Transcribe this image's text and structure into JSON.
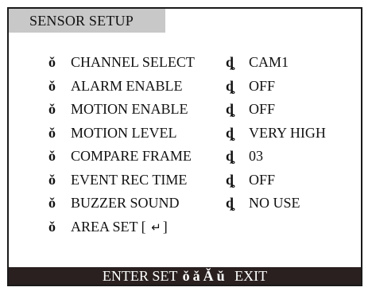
{
  "screen": {
    "title": "SENSOR SETUP"
  },
  "menu": {
    "mark_icon": "selector-mark-icon",
    "sep_glyph": "ȡ",
    "mark_glyph": "ǒ",
    "items": [
      {
        "label": "CHANNEL SELECT",
        "value": "CAM1"
      },
      {
        "label": "ALARM ENABLE",
        "value": "OFF"
      },
      {
        "label": "MOTION ENABLE",
        "value": "OFF"
      },
      {
        "label": "MOTION LEVEL",
        "value": "VERY HIGH"
      },
      {
        "label": "COMPARE  FRAME",
        "value": "03"
      },
      {
        "label": "EVENT REC TIME",
        "value": "OFF"
      },
      {
        "label": "BUZZER  SOUND",
        "value": "NO USE"
      }
    ],
    "area_set": {
      "label": "AREA  SET  [",
      "enter_glyph": "↵",
      "close": "]"
    }
  },
  "footer": {
    "enter": "ENTER",
    "set": "SET",
    "arrows": [
      "ǒ",
      "ǎ",
      "Ǎ",
      "ǔ"
    ],
    "exit": "EXIT"
  }
}
